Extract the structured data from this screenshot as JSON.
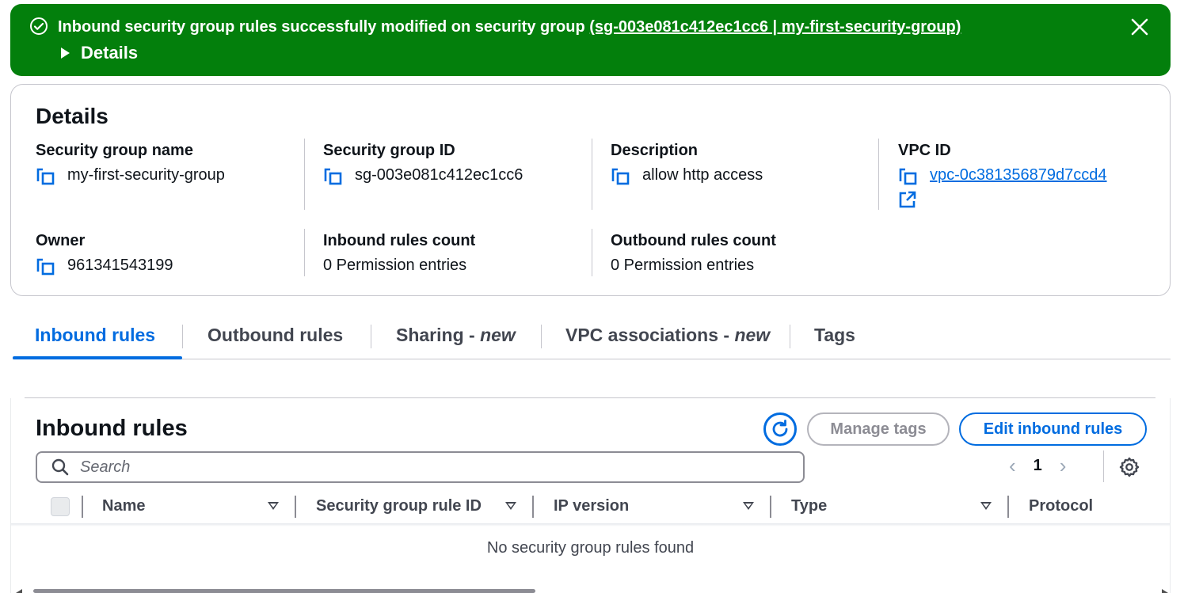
{
  "flash": {
    "message_prefix": "Inbound security group rules successfully modified on security group ",
    "message_link": "(sg-003e081c412ec1cc6 | my-first-security-group)",
    "details_label": "Details",
    "type": "success",
    "icons": {
      "status": "check-circle-icon",
      "close": "close-icon"
    }
  },
  "details": {
    "title": "Details",
    "fields": {
      "sg_name": {
        "label": "Security group name",
        "value": "my-first-security-group"
      },
      "sg_id": {
        "label": "Security group ID",
        "value": "sg-003e081c412ec1cc6"
      },
      "description": {
        "label": "Description",
        "value": "allow http access"
      },
      "vpc_id": {
        "label": "VPC ID",
        "value": "vpc-0c381356879d7ccd4"
      },
      "owner": {
        "label": "Owner",
        "value": "961341543199"
      },
      "inbound_count": {
        "label": "Inbound rules count",
        "value": "0 Permission entries"
      },
      "outbound_count": {
        "label": "Outbound rules count",
        "value": "0 Permission entries"
      }
    }
  },
  "tabs": [
    {
      "label": "Inbound rules",
      "suffix": "",
      "active": true
    },
    {
      "label": "Outbound rules",
      "suffix": "",
      "active": false
    },
    {
      "label": "Sharing - ",
      "suffix": "new",
      "active": false
    },
    {
      "label": "VPC associations - ",
      "suffix": "new",
      "active": false
    },
    {
      "label": "Tags",
      "suffix": "",
      "active": false
    }
  ],
  "inbound": {
    "title": "Inbound rules",
    "manage_tags_label": "Manage tags",
    "edit_label": "Edit inbound rules",
    "search_placeholder": "Search",
    "page": "1",
    "columns": [
      "Name",
      "Security group rule ID",
      "IP version",
      "Type",
      "Protocol"
    ],
    "empty_message": "No security group rules found"
  },
  "colors": {
    "success": "#037f0c",
    "accent": "#006ce0",
    "text": "#0f141a",
    "muted": "#424650",
    "border": "#c6c6cd"
  }
}
